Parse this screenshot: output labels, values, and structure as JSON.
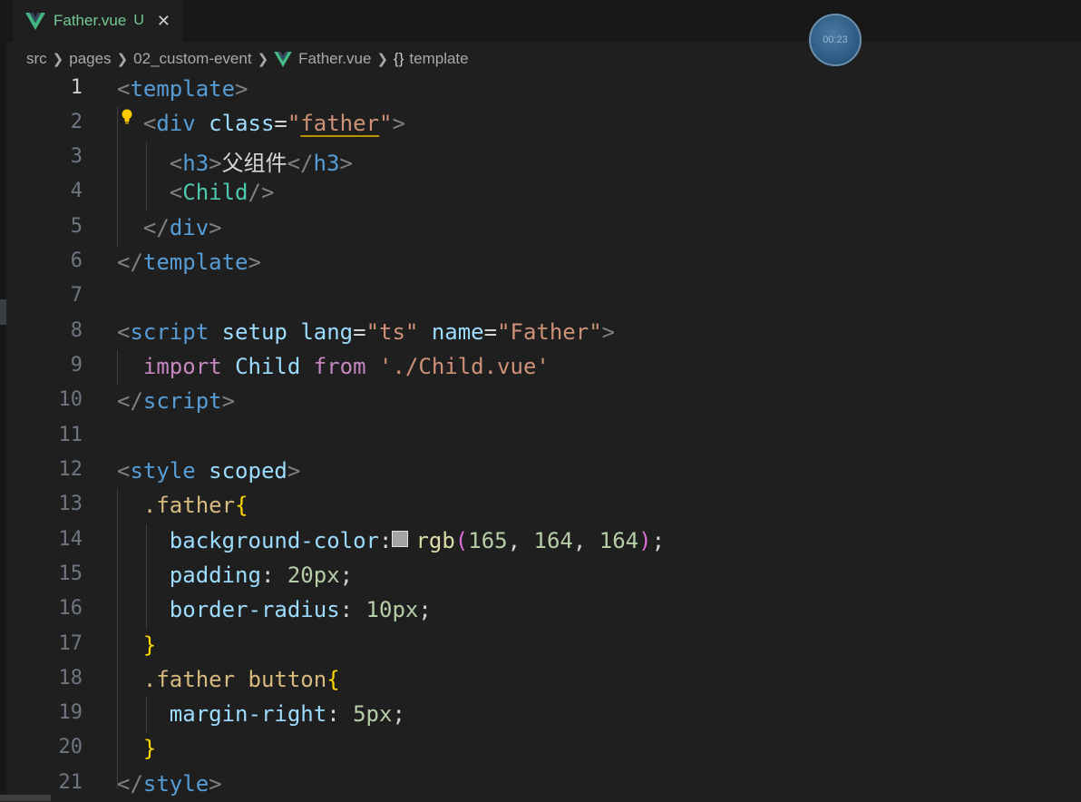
{
  "tab": {
    "title": "Father.vue",
    "status": "U",
    "close_icon": "close-icon",
    "vue_color": "#41b883",
    "active_text_color": "#73c991"
  },
  "timer": {
    "label": "00:23"
  },
  "breadcrumb": {
    "items": [
      "src",
      "pages",
      "02_custom-event",
      "Father.vue",
      "template"
    ],
    "braces_glyph": "{}"
  },
  "editor": {
    "colors": {
      "tag": "#569cd6",
      "attr": "#9cdcfe",
      "string": "#ce9178",
      "keyword": "#c586c0",
      "selector": "#d7ba7d",
      "number": "#b5cea8"
    },
    "lines": [
      {
        "n": "1"
      },
      {
        "n": "2"
      },
      {
        "n": "3"
      },
      {
        "n": "4"
      },
      {
        "n": "5"
      },
      {
        "n": "6"
      },
      {
        "n": "7"
      },
      {
        "n": "8"
      },
      {
        "n": "9"
      },
      {
        "n": "10"
      },
      {
        "n": "11"
      },
      {
        "n": "12"
      },
      {
        "n": "13"
      },
      {
        "n": "14"
      },
      {
        "n": "15"
      },
      {
        "n": "16"
      },
      {
        "n": "17"
      },
      {
        "n": "18"
      },
      {
        "n": "19"
      },
      {
        "n": "20"
      },
      {
        "n": "21"
      }
    ],
    "tokens": {
      "l1": {
        "lt": "<",
        "tag": "template",
        "gt": ">"
      },
      "l2": {
        "lt": "<",
        "tag": "div",
        "attr": "class",
        "eq": "=",
        "q1": "\"",
        "value": "father",
        "q2": "\"",
        "gt": ">"
      },
      "l3": {
        "lt": "<",
        "tag": "h3",
        "gt": ">",
        "text": "父组件",
        "close_lt": "</",
        "close_gt": ">"
      },
      "l4": {
        "lt": "<",
        "tag": "Child",
        "gt": "/>"
      },
      "l5": {
        "lt": "</",
        "tag": "div",
        "gt": ">"
      },
      "l6": {
        "lt": "</",
        "tag": "template",
        "gt": ">"
      },
      "l8": {
        "lt": "<",
        "tag": "script",
        "attr1": "setup",
        "attr2": "lang",
        "eq1": "=",
        "v2": "\"ts\"",
        "attr3": "name",
        "eq2": "=",
        "v3": "\"Father\"",
        "gt": ">"
      },
      "l9": {
        "kw1": "import",
        "ident": "Child",
        "kw2": "from",
        "str": "'./Child.vue'"
      },
      "l10": {
        "lt": "</",
        "tag": "script",
        "gt": ">"
      },
      "l12": {
        "lt": "<",
        "tag": "style",
        "attr": "scoped",
        "gt": ">"
      },
      "l13": {
        "sel": ".father",
        "brace": "{"
      },
      "l14": {
        "prop": "background-color",
        "colon": ":",
        "fn": "rgb",
        "open": "(",
        "n1": "165",
        "c1": ", ",
        "n2": "164",
        "c2": ", ",
        "n3": "164",
        "close": ")",
        "semi": ";"
      },
      "l15": {
        "prop": "padding",
        "colon": ": ",
        "val": "20px",
        "semi": ";"
      },
      "l16": {
        "prop": "border-radius",
        "colon": ": ",
        "val": "10px",
        "semi": ";"
      },
      "l17": {
        "brace": "}"
      },
      "l18": {
        "sel": ".father button",
        "brace": "{"
      },
      "l19": {
        "prop": "margin-right",
        "colon": ": ",
        "val": "5px",
        "semi": ";"
      },
      "l20": {
        "brace": "}"
      },
      "l21": {
        "lt": "</",
        "tag": "style",
        "gt": ">"
      }
    }
  }
}
